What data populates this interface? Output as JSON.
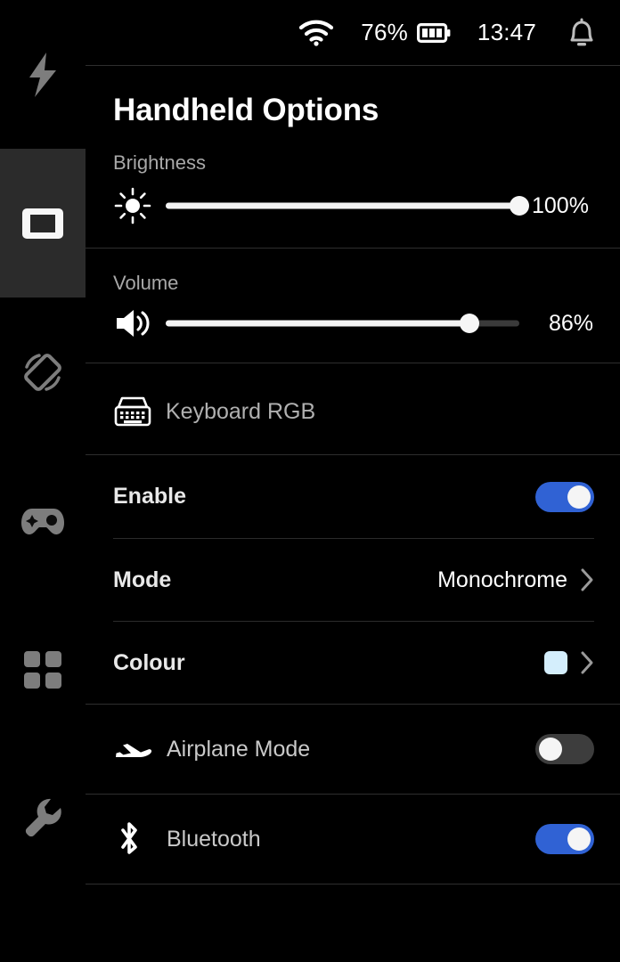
{
  "statusbar": {
    "wifi_icon": "wifi-icon",
    "battery_percent": "76%",
    "battery_icon": "battery-icon",
    "clock": "13:47",
    "notification_icon": "bell-icon"
  },
  "sidebar": {
    "items": [
      {
        "name": "performance",
        "icon": "lightning-bolt-icon",
        "active": false
      },
      {
        "name": "handheld",
        "icon": "handheld-display-icon",
        "active": true
      },
      {
        "name": "rotation",
        "icon": "screen-rotation-icon",
        "active": false
      },
      {
        "name": "controller",
        "icon": "gamepad-icon",
        "active": false
      },
      {
        "name": "apps",
        "icon": "grid-apps-icon",
        "active": false
      },
      {
        "name": "tools",
        "icon": "wrench-icon",
        "active": false
      }
    ]
  },
  "page": {
    "title": "Handheld Options"
  },
  "brightness": {
    "label": "Brightness",
    "icon": "brightness-sun-icon",
    "value": "100%",
    "percent": 100
  },
  "volume": {
    "label": "Volume",
    "icon": "speaker-volume-icon",
    "value": "86%",
    "percent": 86
  },
  "keyboard_rgb": {
    "title": "Keyboard RGB",
    "icon": "keyboard-icon",
    "enable": {
      "label": "Enable",
      "state": "on"
    },
    "mode": {
      "label": "Mode",
      "value": "Monochrome",
      "chevron": "chevron-right-icon"
    },
    "colour": {
      "label": "Colour",
      "swatch_hex": "#d4eefc",
      "chevron": "chevron-right-icon"
    }
  },
  "devices": [
    {
      "label": "Airplane Mode",
      "icon": "airplane-icon",
      "state": "off"
    },
    {
      "label": "Bluetooth",
      "icon": "bluetooth-icon",
      "state": "on"
    }
  ],
  "colors": {
    "accent_blue": "#3062d4",
    "toggle_off": "#3d3d3d",
    "background": "#000000",
    "active_rail": "#2b2b2b",
    "divider": "#2e2e2e"
  }
}
